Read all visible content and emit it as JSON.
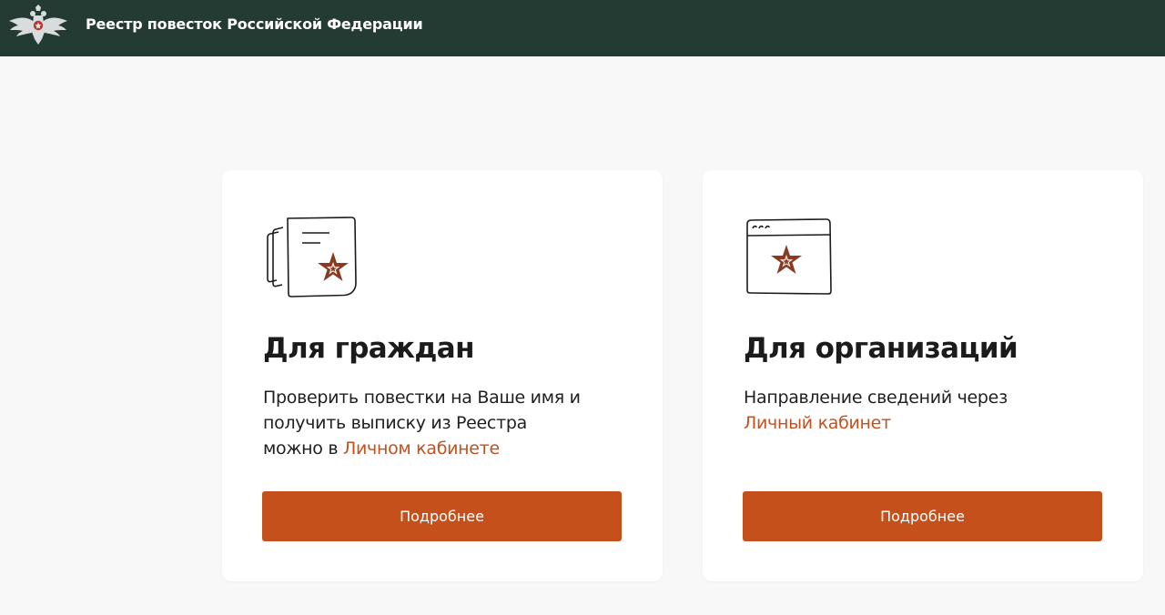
{
  "header": {
    "title": "Реестр повесток Российской Федерации",
    "emblem_icon": "double-headed-eagle-emblem-icon",
    "background_color": "#233b33"
  },
  "cards": [
    {
      "icon": "summons-document-star-icon",
      "title": "Для граждан",
      "text_lines": [
        "Проверить повестки на Ваше имя и",
        "получить выписку из Реестра",
        "можно в "
      ],
      "link_text": "Личном кабинете",
      "button_label": "Подробнее"
    },
    {
      "icon": "browser-window-star-icon",
      "title": "Для организаций",
      "text_lines": [
        "Направление сведений через"
      ],
      "link_text": "Личный кабинет",
      "button_label": "Подробнее"
    }
  ],
  "colors": {
    "accent": "#c5501b",
    "star": "#8b3a22",
    "page_background": "#f8f8f8",
    "card_background": "#ffffff",
    "text": "#1f1f1f"
  }
}
